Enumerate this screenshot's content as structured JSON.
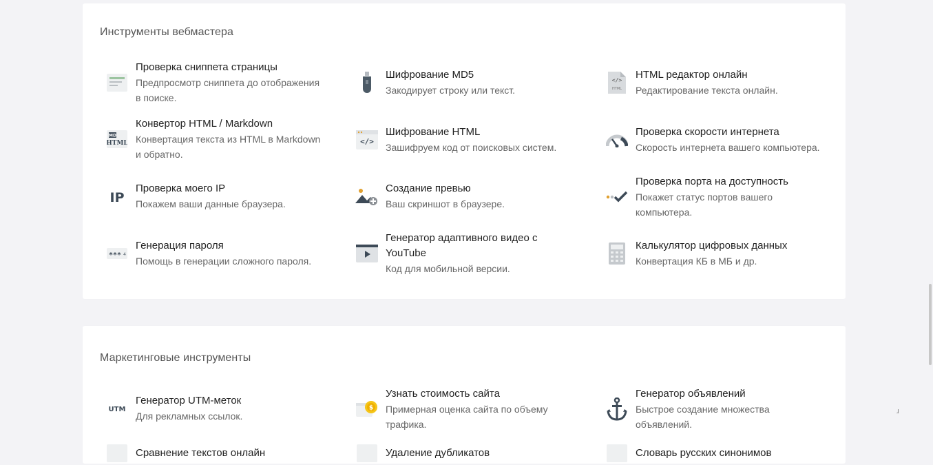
{
  "webmaster": {
    "title": "Инструменты вебмастера",
    "tools": [
      {
        "name": "Проверка сниппета страницы",
        "desc1": "Предпросмотр сниппета до отображения",
        "desc2": "в поиске."
      },
      {
        "name": "Шифрование MD5",
        "desc1": "Закодирует строку или текст.",
        "desc2": ""
      },
      {
        "name": "HTML редактор онлайн",
        "desc1": "Редактирование текста онлайн.",
        "desc2": ""
      },
      {
        "name": "Конвертор HTML / Markdown",
        "desc1": "Конвертация текста из HTML в Markdown",
        "desc2": "и обратно."
      },
      {
        "name": "Шифрование HTML",
        "desc1": "Зашифруем код от поисковых систем.",
        "desc2": ""
      },
      {
        "name": "Проверка скорости интернета",
        "desc1": "Скорость интернета вашего компьютера.",
        "desc2": ""
      },
      {
        "name": "Проверка моего IP",
        "desc1": "Покажем ваши данные браузера.",
        "desc2": ""
      },
      {
        "name": "Создание превью",
        "desc1": "Ваш скриншот в браузере.",
        "desc2": ""
      },
      {
        "name": "Проверка порта на доступность",
        "desc1": "Покажет статус портов вашего",
        "desc2": "компьютера."
      },
      {
        "name": "Генерация пароля",
        "desc1": "Помощь в генерации сложного пароля.",
        "desc2": ""
      },
      {
        "name": "Генератор адаптивного видео с",
        "name2": "YouTube",
        "desc1": "Код для мобильной версии.",
        "desc2": ""
      },
      {
        "name": "Калькулятор цифровых данных",
        "desc1": "Конвертация КБ в МБ и др.",
        "desc2": ""
      }
    ],
    "icons": {
      "md_badge": "MD",
      "html_badge": "HTML",
      "code_text": "</>",
      "code_mini": "</>",
      "ip_text": "IP",
      "stars_text": "***",
      "stars_digit": "4",
      "html_file_label": "HTML"
    }
  },
  "marketing": {
    "title": "Маркетинговые инструменты",
    "tools": [
      {
        "name": "Генератор UTM-меток",
        "desc1": "Для рекламных ссылок.",
        "desc2": ""
      },
      {
        "name": "Узнать стоимость сайта",
        "desc1": "Примерная оценка сайта по объему",
        "desc2": "трафика."
      },
      {
        "name": "Генератор объявлений",
        "desc1": "Быстрое создание множества",
        "desc2": "объявлений."
      },
      {
        "name": "Сравнение текстов онлайн",
        "desc1": "",
        "desc2": ""
      },
      {
        "name": "Удаление дубликатов",
        "desc1": "",
        "desc2": ""
      },
      {
        "name": "Словарь русских синонимов",
        "desc1": "",
        "desc2": ""
      }
    ],
    "icons": {
      "utm_text": "UTM",
      "coin_text": "$"
    }
  },
  "colors": {
    "page_bg": "#f3f3f6",
    "card_bg": "#ffffff",
    "icon_gray": "#8a8f94",
    "coin_yellow": "#f5c518",
    "snippet_green": "#9cc4a0"
  },
  "misc": {
    "corner_glyph": "ɹ"
  }
}
